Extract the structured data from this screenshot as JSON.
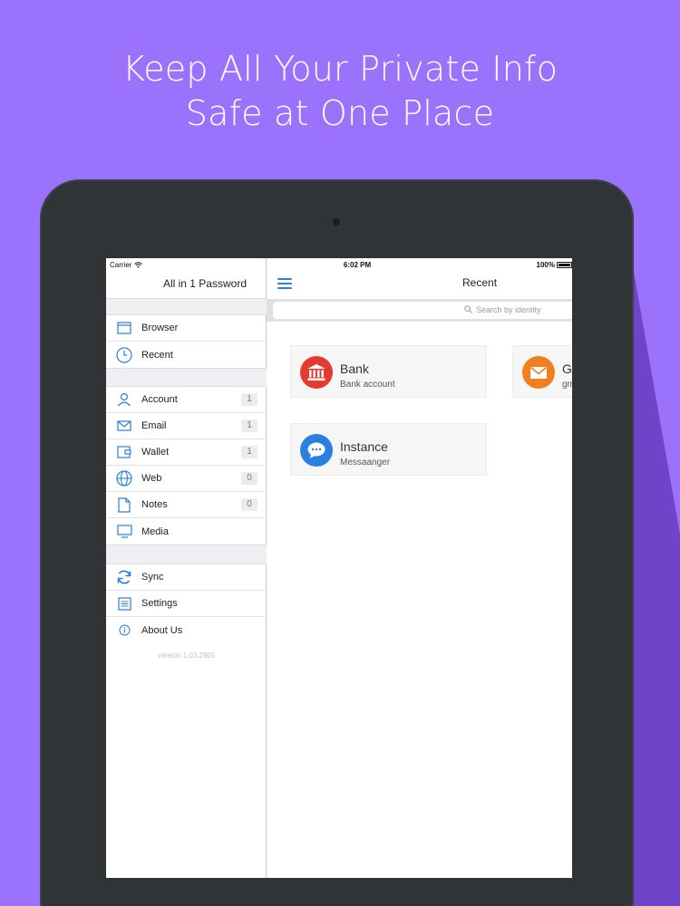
{
  "headline": {
    "line1": "Keep All Your Private Info",
    "line2": "Safe at One Place"
  },
  "colors": {
    "background": "#9a72fb",
    "device": "#303436",
    "accent": "#2c7fd9",
    "bank_icon": "#e53b2f",
    "messenger_icon": "#2a7fe0",
    "mail_icon": "#f07f1d"
  },
  "status_bar": {
    "carrier": "Carrier",
    "time": "6:02 PM",
    "battery": "100%"
  },
  "sidebar": {
    "title": "All in 1 Password",
    "group1": [
      {
        "label": "Browser",
        "icon": "browser-icon"
      },
      {
        "label": "Recent",
        "icon": "clock-icon"
      }
    ],
    "group2": [
      {
        "label": "Account",
        "icon": "person-icon",
        "count": "1"
      },
      {
        "label": "Email",
        "icon": "mail-icon",
        "count": "1"
      },
      {
        "label": "Wallet",
        "icon": "wallet-icon",
        "count": "1"
      },
      {
        "label": "Web",
        "icon": "globe-icon",
        "count": "0"
      },
      {
        "label": "Notes",
        "icon": "document-icon",
        "count": "0"
      },
      {
        "label": "Media",
        "icon": "monitor-icon"
      }
    ],
    "group3": [
      {
        "label": "Sync",
        "icon": "sync-icon"
      },
      {
        "label": "Settings",
        "icon": "sliders-icon"
      },
      {
        "label": "About Us",
        "icon": "info-icon"
      }
    ],
    "version": "version 1.03.2905"
  },
  "main": {
    "title": "Recent",
    "search_placeholder": "Search by identity",
    "cards": [
      {
        "title": "Bank",
        "subtitle": "Bank account",
        "icon": "bank-icon"
      },
      {
        "title": "Instance",
        "subtitle": "Messaanger",
        "icon": "chat-bubble-icon"
      },
      {
        "title": "G",
        "subtitle": "gm",
        "icon": "envelope-icon"
      }
    ]
  }
}
